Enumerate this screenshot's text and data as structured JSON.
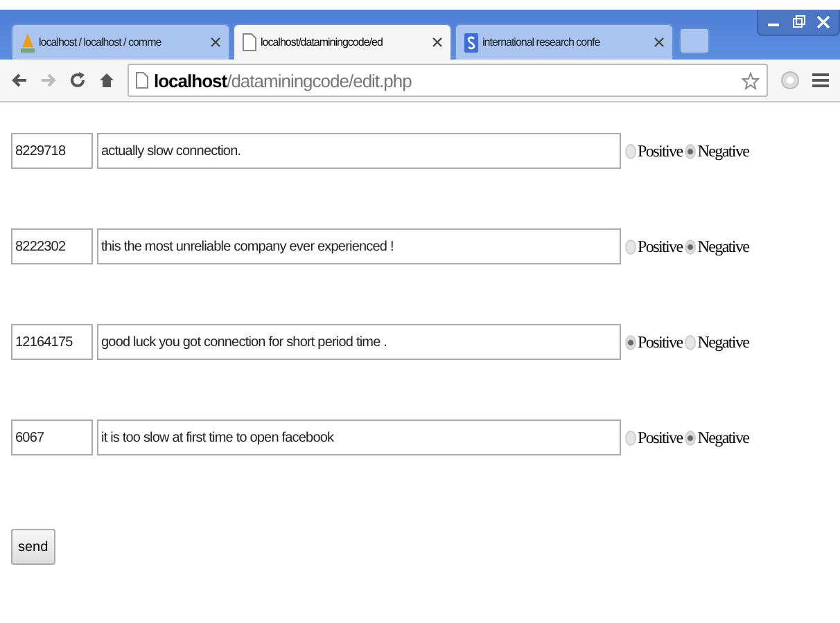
{
  "tabs": [
    {
      "title": "localhost / localhost / comme",
      "selected": false
    },
    {
      "title": "localhost/dataminingcode/ed",
      "selected": true
    },
    {
      "title": "international research confe",
      "selected": false
    }
  ],
  "address_bar": {
    "host": "localhost",
    "path": "/dataminingcode/edit.php"
  },
  "rows": [
    {
      "id": "8229718",
      "text": "actually slow connection.",
      "options": [
        {
          "label": "Positive",
          "selected": false
        },
        {
          "label": "Negative",
          "selected": true
        }
      ]
    },
    {
      "id": "8222302",
      "text": "this the most unreliable company ever experienced !",
      "options": [
        {
          "label": "Positive",
          "selected": false
        },
        {
          "label": "Negative",
          "selected": true
        }
      ]
    },
    {
      "id": "12164175",
      "text": "good luck you got connection for short period time .",
      "options": [
        {
          "label": "Positive",
          "selected": true
        },
        {
          "label": "Negative",
          "selected": false
        }
      ]
    },
    {
      "id": "6067",
      "text": "it is too slow at first time to open facebook",
      "options": [
        {
          "label": "Positive",
          "selected": false
        },
        {
          "label": "Negative",
          "selected": true
        }
      ]
    }
  ],
  "submit_button": "send"
}
